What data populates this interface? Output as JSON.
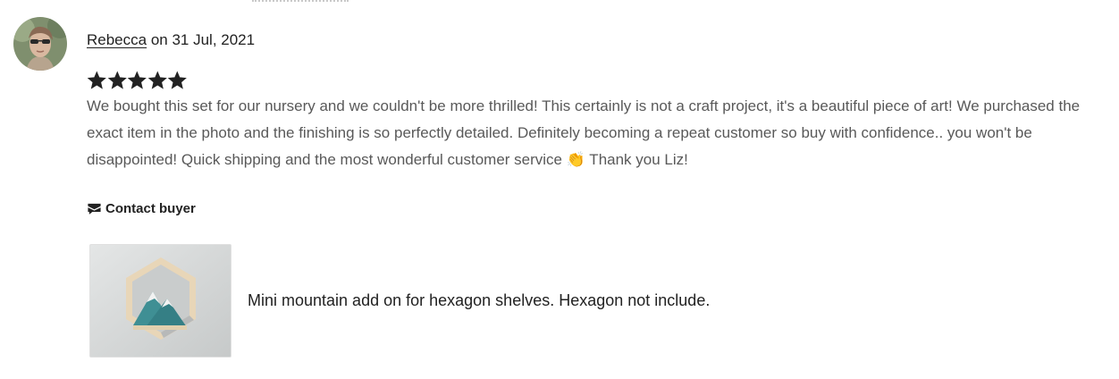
{
  "review": {
    "reviewer_name": "Rebecca",
    "date_text": " on 31 Jul, 2021",
    "rating": 5,
    "rating_max": 5,
    "text": "We bought this set for our nursery and we couldn't be more thrilled! This certainly is not a craft project, it's a beautiful piece of art! We purchased the exact item in the photo and the finishing is so perfectly detailed. Definitely becoming a repeat customer so buy with confidence.. you won't be disappointed! Quick shipping and the most wonderful customer service 👏 Thank you Liz!",
    "contact_label": "Contact buyer"
  },
  "product": {
    "title": "Mini mountain add on for hexagon shelves. Hexagon not include."
  },
  "icons": {
    "avatar": "reviewer-avatar",
    "star": "star-icon",
    "contact": "message-icon",
    "thumbnail": "product-thumbnail"
  },
  "colors": {
    "text": "#222222",
    "body_text": "#595959",
    "star": "#222222",
    "teal": "#3f8f94"
  }
}
